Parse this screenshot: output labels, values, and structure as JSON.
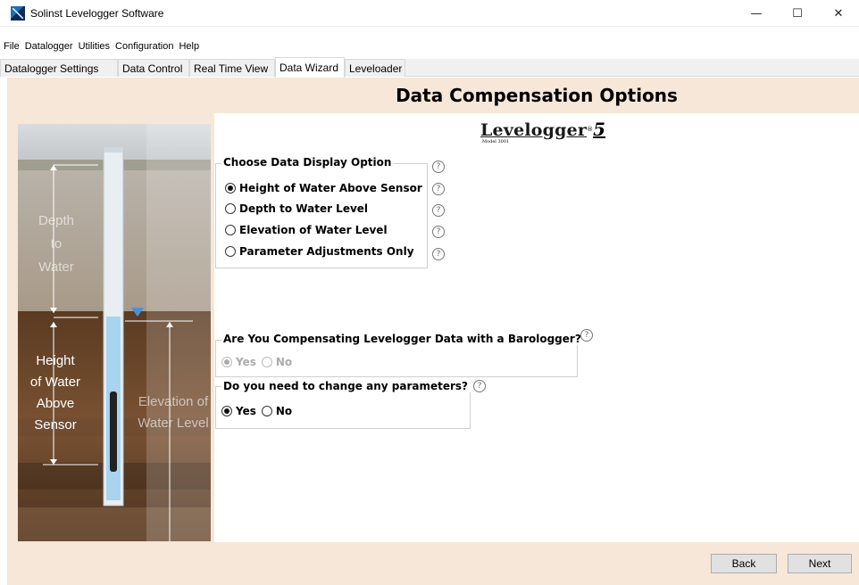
{
  "window": {
    "title": "Solinst Levelogger Software",
    "minimize": "—",
    "maximize": "☐",
    "close": "✕"
  },
  "menu": [
    "File",
    "Datalogger",
    "Utilities",
    "Configuration",
    "Help"
  ],
  "tabs": [
    {
      "label": "Datalogger Settings",
      "active": false
    },
    {
      "label": "Data Control",
      "active": false
    },
    {
      "label": "Real Time View",
      "active": false
    },
    {
      "label": "Data Wizard",
      "active": true
    },
    {
      "label": "Leveloader",
      "active": false
    }
  ],
  "page": {
    "heading": "Data Compensation Options"
  },
  "illustration": {
    "depth_to_water": [
      "Depth",
      "to",
      "Water"
    ],
    "height_of_water": [
      "Height",
      "of Water",
      "Above",
      "Sensor"
    ],
    "elevation": [
      "Elevation of",
      "Water Level"
    ]
  },
  "logo": {
    "name": "Levelogger",
    "version": "5",
    "registered": "®",
    "model": "Model 3001"
  },
  "display_option": {
    "legend": "Choose Data Display Option",
    "options": [
      {
        "label": "Height of Water Above Sensor",
        "checked": true
      },
      {
        "label": "Depth to Water Level",
        "checked": false
      },
      {
        "label": "Elevation of Water Level",
        "checked": false
      },
      {
        "label": "Parameter Adjustments Only",
        "checked": false
      }
    ]
  },
  "barologger": {
    "legend": "Are You Compensating Levelogger Data with a Barologger?",
    "yes": "Yes",
    "no": "No",
    "selected": "Yes",
    "enabled": false
  },
  "parameters": {
    "legend": "Do you need to change any parameters?",
    "yes": "Yes",
    "no": "No",
    "selected": "Yes"
  },
  "help_glyph": "?",
  "footer": {
    "back": "Back",
    "next": "Next"
  },
  "colors": {
    "panel_bg": "#f6e7d8",
    "water": "#a8d4f0",
    "marker": "#4a90d9"
  }
}
